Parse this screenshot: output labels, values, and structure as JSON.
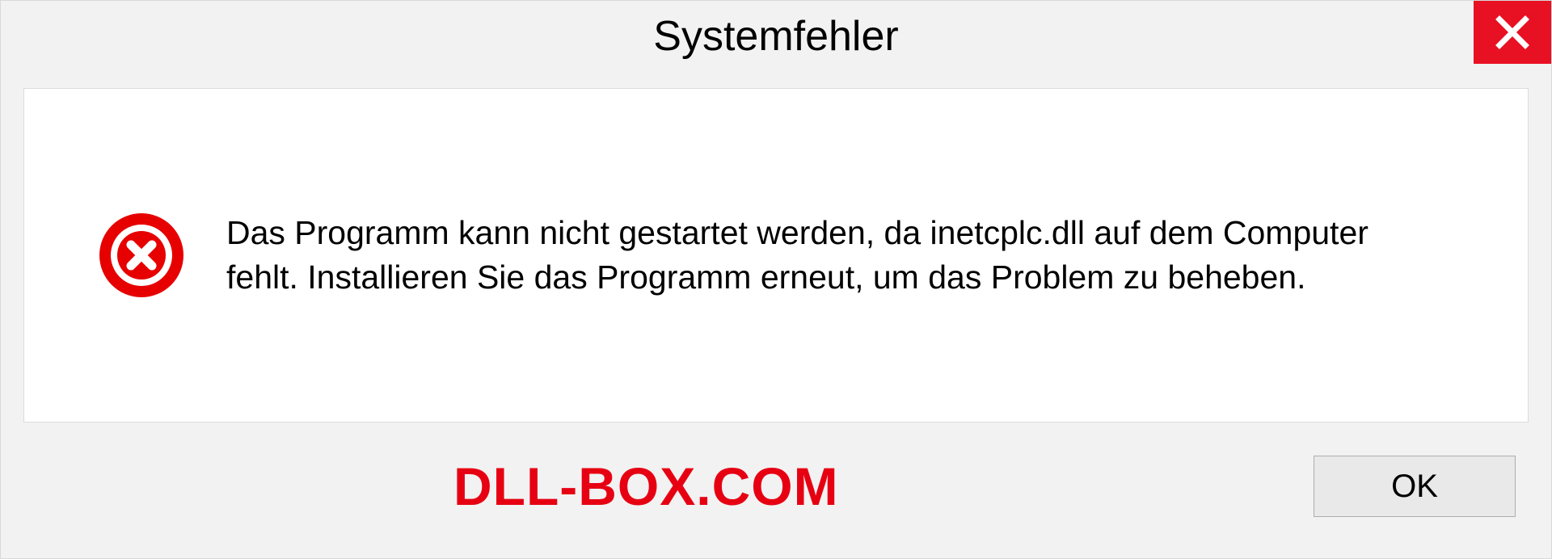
{
  "dialog": {
    "title": "Systemfehler",
    "message": "Das Programm kann nicht gestartet werden, da inetcplc.dll auf dem Computer fehlt. Installieren Sie das Programm erneut, um das Problem zu beheben.",
    "ok_label": "OK"
  },
  "watermark": "DLL-BOX.COM"
}
